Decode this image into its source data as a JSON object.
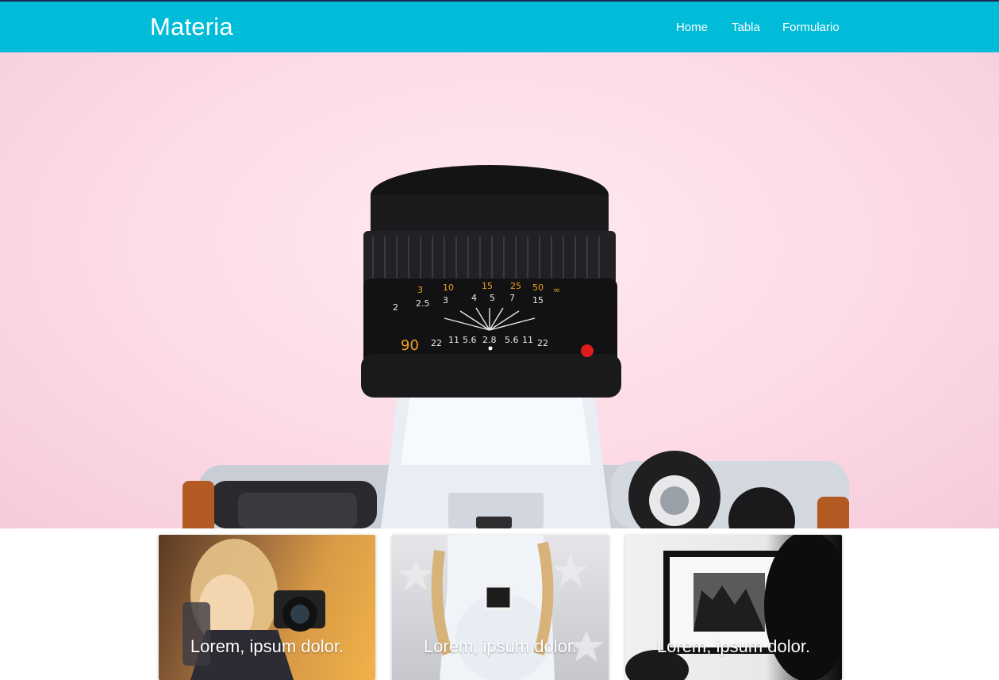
{
  "navbar": {
    "brand": "Materia",
    "links": [
      {
        "label": "Home"
      },
      {
        "label": "Tabla"
      },
      {
        "label": "Formulario"
      }
    ],
    "background": "#00bcd9",
    "top_border": "#1d2b57"
  },
  "hero": {
    "image": "camera-lens-on-pink",
    "lens_focus_scale": [
      "2",
      "2.5",
      "3",
      "4",
      "5",
      "7",
      "15",
      "22",
      "11",
      "5.6",
      "2.8",
      "5.6",
      "11",
      "22"
    ],
    "lens_distance_scale": [
      "3",
      "10",
      "15",
      "25",
      "50",
      "∞"
    ],
    "lens_badge": "90"
  },
  "cards": [
    {
      "image": "girl-with-camera",
      "caption": "Lorem, ipsum dolor."
    },
    {
      "image": "pregnant-woman-with-ultrasound",
      "caption": "Lorem, ipsum dolor."
    },
    {
      "image": "framed-photo-on-wall",
      "caption": "Lorem, ipsum dolor."
    }
  ]
}
